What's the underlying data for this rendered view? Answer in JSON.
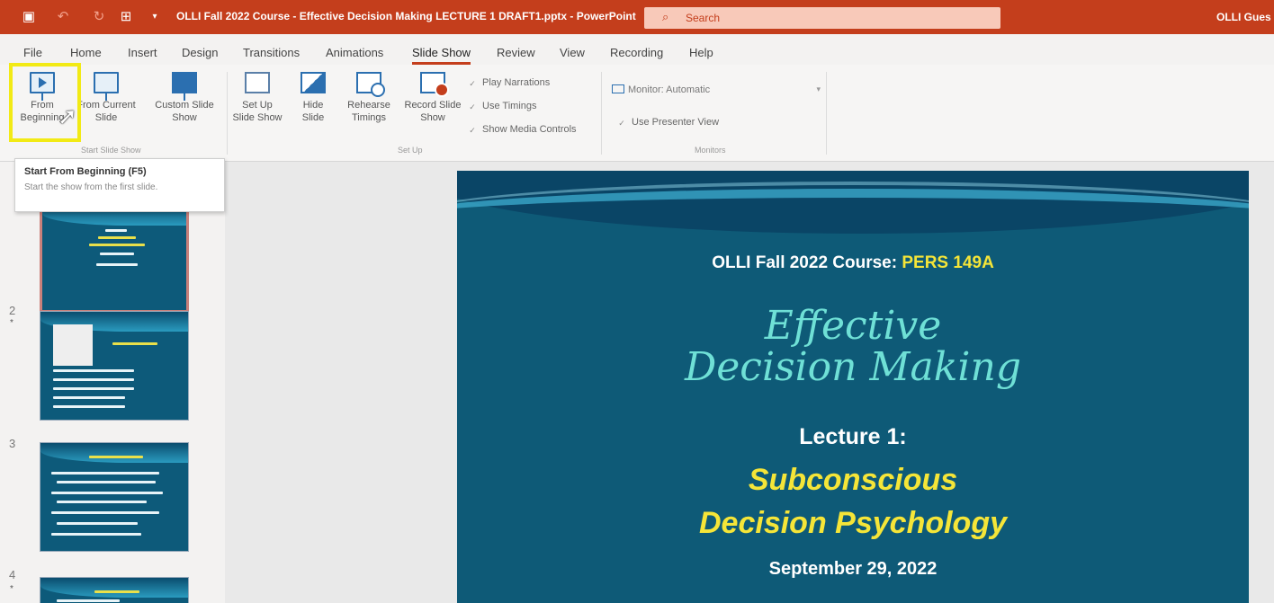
{
  "titlebar": {
    "doc_title": "OLLI Fall 2022 Course - Effective Decision Making LECTURE 1 DRAFT1.pptx  -  PowerPoint",
    "search_placeholder": "Search",
    "user": "OLLI Gues"
  },
  "tabs": [
    "File",
    "Home",
    "Insert",
    "Design",
    "Transitions",
    "Animations",
    "Slide Show",
    "Review",
    "View",
    "Recording",
    "Help"
  ],
  "active_tab": "Slide Show",
  "ribbon": {
    "from_beginning": "From Beginning",
    "from_current": "From Current Slide",
    "custom_show": "Custom Slide Show",
    "group_start": "Start Slide Show",
    "set_up": "Set Up Slide Show",
    "hide_slide": "Hide Slide",
    "rehearse": "Rehearse Timings",
    "record": "Record Slide Show",
    "play_narrations": "Play Narrations",
    "use_timings": "Use Timings",
    "show_media": "Show Media Controls",
    "group_setup": "Set Up",
    "monitor": "Monitor:  Automatic",
    "presenter_view": "Use Presenter View",
    "group_monitors": "Monitors"
  },
  "tooltip": {
    "title": "Start From Beginning (F5)",
    "desc": "Start the show from the first slide."
  },
  "thumbnails": [
    {
      "num": "",
      "dot": ""
    },
    {
      "num": "2",
      "dot": "*"
    },
    {
      "num": "3",
      "dot": ""
    },
    {
      "num": "4",
      "dot": "*"
    }
  ],
  "slide": {
    "course_prefix": "OLLI Fall 2022 Course: ",
    "course_code": "PERS 149A",
    "title_line1": "Effective",
    "title_line2": "Decision Making",
    "lecture": "Lecture 1:",
    "topic_line1": "Subconscious",
    "topic_line2": "Decision Psychology",
    "date": "September 29, 2022"
  },
  "colors": {
    "titlebar": "#c43e1c",
    "slide_bg": "#0e5a77",
    "slide_accent_yellow": "#f5e538",
    "slide_title_teal": "#6fe0d6",
    "highlight": "#f2ea15"
  }
}
